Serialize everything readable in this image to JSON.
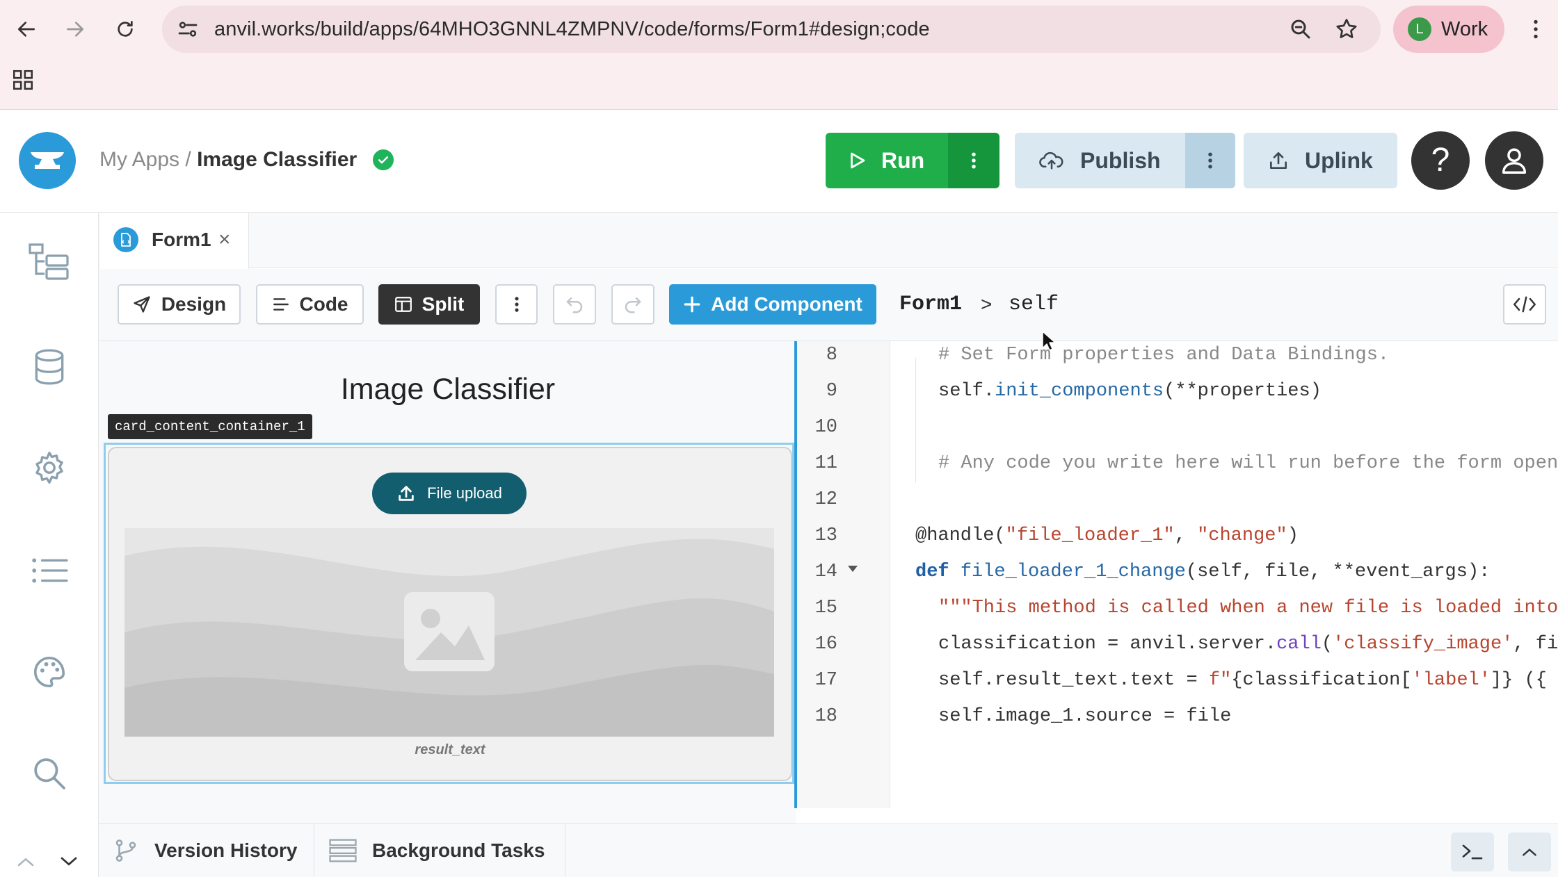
{
  "browser": {
    "url": "anvil.works/build/apps/64MHO3GNNL4ZMPNV/code/forms/Form1#design;code",
    "profile_initial": "L",
    "profile_label": "Work"
  },
  "header": {
    "breadcrumb_root": "My Apps",
    "breadcrumb_sep": "/",
    "app_name": "Image Classifier",
    "run_label": "Run",
    "publish_label": "Publish",
    "uplink_label": "Uplink",
    "help_label": "?"
  },
  "tabs": [
    {
      "label": "Form1",
      "close": "×"
    }
  ],
  "toolbar": {
    "design_label": "Design",
    "code_label": "Code",
    "split_label": "Split",
    "add_component_label": "Add Component",
    "path_form": "Form1",
    "path_sep": ">",
    "path_self": "self"
  },
  "design": {
    "title": "Image Classifier",
    "container_label": "card_content_container_1",
    "file_upload_label": "File upload",
    "result_text": "result_text"
  },
  "code": {
    "line_numbers": [
      "8",
      "9",
      "10",
      "11",
      "12",
      "13",
      "14",
      "15",
      "16",
      "17",
      "18"
    ],
    "lines": {
      "l8": "# Set Form properties and Data Bindings.",
      "l9_a": "self.",
      "l9_b": "init_components",
      "l9_c": "(**properties)",
      "l11": "# Any code you write here will run before the form opens.",
      "l13_a": "@handle(",
      "l13_b": "\"file_loader_1\"",
      "l13_c": ", ",
      "l13_d": "\"change\"",
      "l13_e": ")",
      "l14_a": "def ",
      "l14_b": "file_loader_1_change",
      "l14_c": "(self, file, **event_args):",
      "l15": "\"\"\"This method is called when a new file is loaded into this FileLoader\"\"\"",
      "l16_a": "classification = anvil.server.",
      "l16_b": "call",
      "l16_c": "(",
      "l16_d": "'classify_image'",
      "l16_e": ", file)",
      "l17_a": "self.result_text.text = ",
      "l17_b": "f\"",
      "l17_c": "{classification[",
      "l17_d": "'label'",
      "l17_e": "]} ({",
      "l18": "self.image_1.source = file"
    }
  },
  "bottom": {
    "version_history_label": "Version History",
    "background_tasks_label": "Background Tasks"
  },
  "colors": {
    "run_green": "#1fae4a",
    "anvil_blue": "#2a9bd8",
    "upload_teal": "#135e6e",
    "browser_pink": "#fbeef1"
  }
}
